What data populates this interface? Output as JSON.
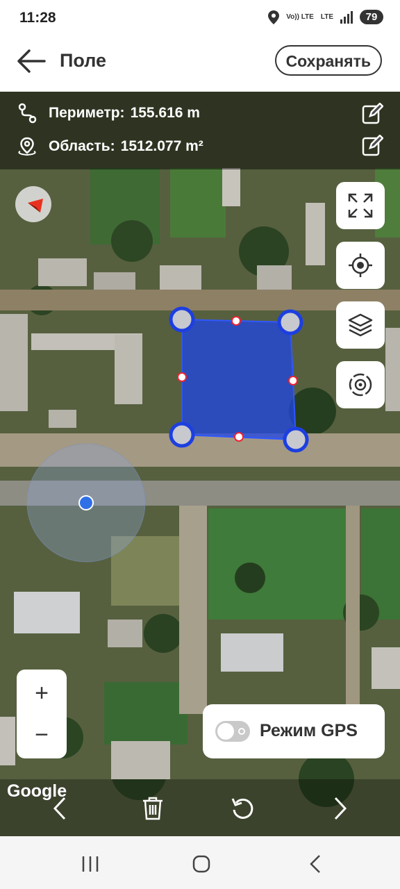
{
  "status": {
    "time": "11:28",
    "network_top": "Vo)) LTE",
    "network_bottom": "LTE",
    "battery": "79"
  },
  "header": {
    "title": "Поле",
    "save_label": "Сохранять"
  },
  "info": {
    "perimeter_label": "Периметр:",
    "perimeter_value": "155.616 m",
    "area_label": "Область:",
    "area_value": "1512.077 m²"
  },
  "controls": {
    "zoom_in": "+",
    "zoom_out": "−",
    "gps_mode_label": "Режим GPS",
    "gps_mode_on": false
  },
  "map": {
    "attribution": "Google",
    "polygon_color": "#1f45e6"
  },
  "icons": {
    "back": "arrow-left-icon",
    "route": "route-icon",
    "pin": "location-pin-icon",
    "edit": "edit-pencil-icon",
    "compass": "compass-icon",
    "fullscreen": "fullscreen-icon",
    "locate": "crosshair-icon",
    "layers": "layers-icon",
    "target": "target-icon",
    "prev": "chevron-left-icon",
    "delete": "trash-icon",
    "undo": "undo-icon",
    "next": "chevron-right-icon"
  }
}
